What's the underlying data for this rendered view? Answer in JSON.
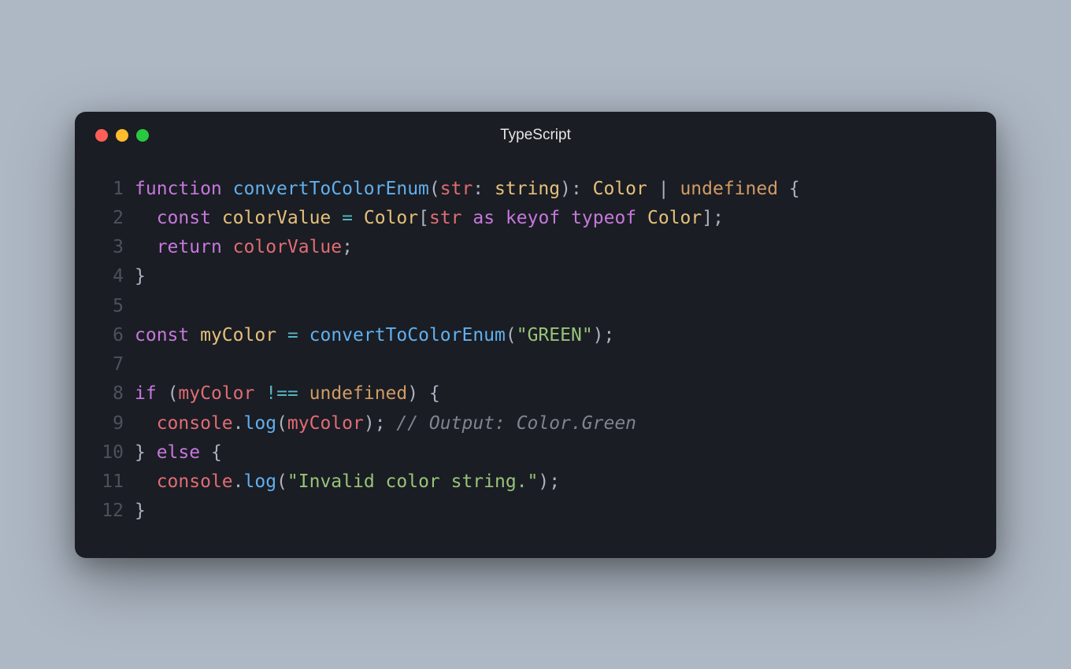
{
  "window": {
    "title": "TypeScript"
  },
  "code": {
    "lines": [
      {
        "num": "1",
        "tokens": [
          {
            "cls": "tok-kw",
            "text": "function"
          },
          {
            "cls": "tok-plain",
            "text": " "
          },
          {
            "cls": "tok-fn",
            "text": "convertToColorEnum"
          },
          {
            "cls": "tok-punc",
            "text": "("
          },
          {
            "cls": "tok-var",
            "text": "str"
          },
          {
            "cls": "tok-punc",
            "text": ": "
          },
          {
            "cls": "tok-type",
            "text": "string"
          },
          {
            "cls": "tok-punc",
            "text": "): "
          },
          {
            "cls": "tok-type",
            "text": "Color"
          },
          {
            "cls": "tok-punc",
            "text": " | "
          },
          {
            "cls": "tok-const",
            "text": "undefined"
          },
          {
            "cls": "tok-punc",
            "text": " {"
          }
        ]
      },
      {
        "num": "2",
        "tokens": [
          {
            "cls": "tok-plain",
            "text": "  "
          },
          {
            "cls": "tok-kw",
            "text": "const"
          },
          {
            "cls": "tok-plain",
            "text": " "
          },
          {
            "cls": "tok-param",
            "text": "colorValue"
          },
          {
            "cls": "tok-plain",
            "text": " "
          },
          {
            "cls": "tok-op",
            "text": "="
          },
          {
            "cls": "tok-plain",
            "text": " "
          },
          {
            "cls": "tok-type",
            "text": "Color"
          },
          {
            "cls": "tok-punc",
            "text": "["
          },
          {
            "cls": "tok-var",
            "text": "str"
          },
          {
            "cls": "tok-plain",
            "text": " "
          },
          {
            "cls": "tok-kw",
            "text": "as"
          },
          {
            "cls": "tok-plain",
            "text": " "
          },
          {
            "cls": "tok-kw",
            "text": "keyof"
          },
          {
            "cls": "tok-plain",
            "text": " "
          },
          {
            "cls": "tok-kw",
            "text": "typeof"
          },
          {
            "cls": "tok-plain",
            "text": " "
          },
          {
            "cls": "tok-type",
            "text": "Color"
          },
          {
            "cls": "tok-punc",
            "text": "];"
          }
        ]
      },
      {
        "num": "3",
        "tokens": [
          {
            "cls": "tok-plain",
            "text": "  "
          },
          {
            "cls": "tok-kw",
            "text": "return"
          },
          {
            "cls": "tok-plain",
            "text": " "
          },
          {
            "cls": "tok-var",
            "text": "colorValue"
          },
          {
            "cls": "tok-punc",
            "text": ";"
          }
        ]
      },
      {
        "num": "4",
        "tokens": [
          {
            "cls": "tok-punc",
            "text": "}"
          }
        ]
      },
      {
        "num": "5",
        "tokens": []
      },
      {
        "num": "6",
        "tokens": [
          {
            "cls": "tok-kw",
            "text": "const"
          },
          {
            "cls": "tok-plain",
            "text": " "
          },
          {
            "cls": "tok-param",
            "text": "myColor"
          },
          {
            "cls": "tok-plain",
            "text": " "
          },
          {
            "cls": "tok-op",
            "text": "="
          },
          {
            "cls": "tok-plain",
            "text": " "
          },
          {
            "cls": "tok-fn",
            "text": "convertToColorEnum"
          },
          {
            "cls": "tok-punc",
            "text": "("
          },
          {
            "cls": "tok-str",
            "text": "\"GREEN\""
          },
          {
            "cls": "tok-punc",
            "text": ");"
          }
        ]
      },
      {
        "num": "7",
        "tokens": []
      },
      {
        "num": "8",
        "tokens": [
          {
            "cls": "tok-kw",
            "text": "if"
          },
          {
            "cls": "tok-plain",
            "text": " "
          },
          {
            "cls": "tok-punc",
            "text": "("
          },
          {
            "cls": "tok-var",
            "text": "myColor"
          },
          {
            "cls": "tok-plain",
            "text": " "
          },
          {
            "cls": "tok-op",
            "text": "!=="
          },
          {
            "cls": "tok-plain",
            "text": " "
          },
          {
            "cls": "tok-const",
            "text": "undefined"
          },
          {
            "cls": "tok-punc",
            "text": ") {"
          }
        ]
      },
      {
        "num": "9",
        "tokens": [
          {
            "cls": "tok-plain",
            "text": "  "
          },
          {
            "cls": "tok-var",
            "text": "console"
          },
          {
            "cls": "tok-punc",
            "text": "."
          },
          {
            "cls": "tok-fn",
            "text": "log"
          },
          {
            "cls": "tok-punc",
            "text": "("
          },
          {
            "cls": "tok-var",
            "text": "myColor"
          },
          {
            "cls": "tok-punc",
            "text": "); "
          },
          {
            "cls": "tok-comment",
            "text": "// Output: Color.Green"
          }
        ]
      },
      {
        "num": "10",
        "tokens": [
          {
            "cls": "tok-punc",
            "text": "} "
          },
          {
            "cls": "tok-kw",
            "text": "else"
          },
          {
            "cls": "tok-punc",
            "text": " {"
          }
        ]
      },
      {
        "num": "11",
        "tokens": [
          {
            "cls": "tok-plain",
            "text": "  "
          },
          {
            "cls": "tok-var",
            "text": "console"
          },
          {
            "cls": "tok-punc",
            "text": "."
          },
          {
            "cls": "tok-fn",
            "text": "log"
          },
          {
            "cls": "tok-punc",
            "text": "("
          },
          {
            "cls": "tok-str",
            "text": "\"Invalid color string.\""
          },
          {
            "cls": "tok-punc",
            "text": ");"
          }
        ]
      },
      {
        "num": "12",
        "tokens": [
          {
            "cls": "tok-punc",
            "text": "}"
          }
        ]
      }
    ]
  }
}
